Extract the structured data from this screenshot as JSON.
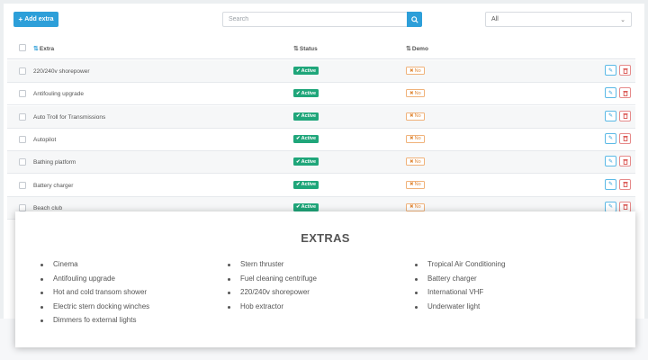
{
  "toolbar": {
    "add_label": "Add extra",
    "search_placeholder": "Search",
    "filter_value": "All"
  },
  "table": {
    "columns": [
      "Extra",
      "Status",
      "Demo"
    ],
    "rows": [
      {
        "name": "220/240v shorepower",
        "status": "Active",
        "demo": "No"
      },
      {
        "name": "Antifouling upgrade",
        "status": "Active",
        "demo": "No"
      },
      {
        "name": "Auto Troll for Transmissions",
        "status": "Active",
        "demo": "No"
      },
      {
        "name": "Autopilot",
        "status": "Active",
        "demo": "No"
      },
      {
        "name": "Bathing platform",
        "status": "Active",
        "demo": "No"
      },
      {
        "name": "Battery charger",
        "status": "Active",
        "demo": "No"
      },
      {
        "name": "Beach club",
        "status": "Active",
        "demo": "No"
      }
    ]
  },
  "card": {
    "title": "EXTRAS",
    "columns": [
      [
        "Cinema",
        "Antifouling upgrade",
        "Hot and cold transom shower",
        "Electric stern docking winches",
        "Dimmers fo external lights"
      ],
      [
        "Stern thruster",
        "Fuel cleaning centrifuge",
        "220/240v shorepower",
        "Hob extractor"
      ],
      [
        "Tropical Air Conditioning",
        "Battery charger",
        "International VHF",
        "Underwater light"
      ]
    ]
  },
  "colors": {
    "accent": "#2d9fd9",
    "active_badge": "#1fa67a",
    "no_badge": "#e08a3c",
    "delete": "#d9534f"
  },
  "icons": {
    "add": "plus-icon",
    "search": "search-icon",
    "filter": "chevron-down-icon",
    "sort": "sort-icon",
    "status_check": "check-icon",
    "demo_no": "x-icon",
    "edit": "pencil-icon",
    "delete": "trash-icon"
  }
}
